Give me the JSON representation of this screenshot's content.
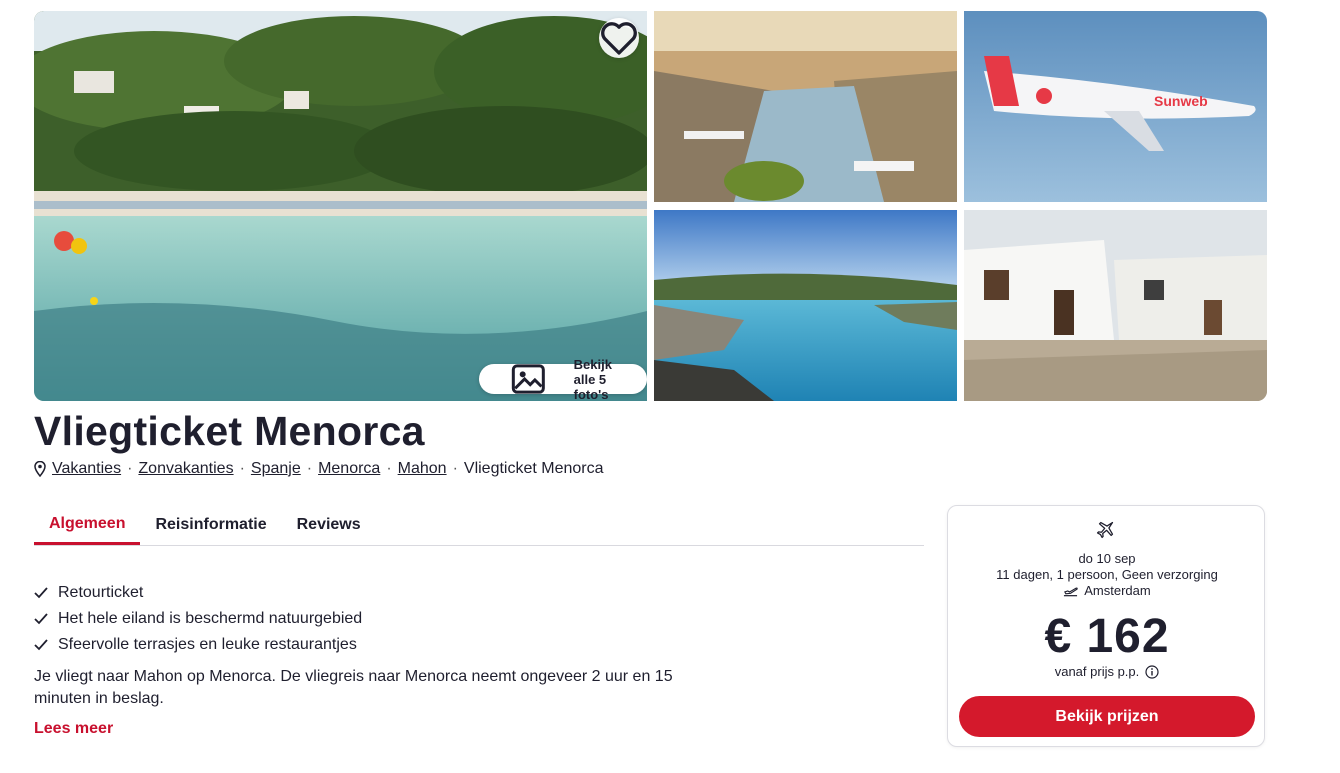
{
  "gallery": {
    "photos": [
      {
        "name": "beach"
      },
      {
        "name": "harbor"
      },
      {
        "name": "airplane"
      },
      {
        "name": "cove"
      },
      {
        "name": "village"
      }
    ],
    "view_all_label": "Bekijk alle 5 foto's",
    "favorite_icon": "heart-icon",
    "view_all_icon": "gallery-icon"
  },
  "page": {
    "title": "Vliegticket Menorca"
  },
  "breadcrumb": {
    "icon": "location-pin-icon",
    "items": [
      "Vakanties",
      "Zonvakanties",
      "Spanje",
      "Menorca",
      "Mahon"
    ],
    "current": "Vliegticket Menorca",
    "separator": "·"
  },
  "tabs": [
    {
      "label": "Algemeen",
      "active": true
    },
    {
      "label": "Reisinformatie",
      "active": false
    },
    {
      "label": "Reviews",
      "active": false
    }
  ],
  "features": [
    "Retourticket",
    "Het hele eiland is beschermd natuurgebied",
    "Sfeervolle terrasjes en leuke restaurantjes"
  ],
  "description": "Je vliegt naar Mahon op Menorca. De vliegreis naar Menorca neemt ongeveer 2 uur en 15 minuten in beslag.",
  "read_more_label": "Lees meer",
  "price_card": {
    "icon": "airplane-icon",
    "date": "do 10 sep",
    "duration": "11 dagen, 1 persoon, Geen verzorging",
    "departure": "Amsterdam",
    "departure_icon": "departure-plane-icon",
    "price": "€ 162",
    "from_label": "vanaf prijs p.p.",
    "info_icon": "info-icon",
    "button_label": "Bekijk prijzen"
  },
  "colors": {
    "accent": "#c8102e",
    "button": "#d4192c",
    "text": "#1f1f2e"
  }
}
